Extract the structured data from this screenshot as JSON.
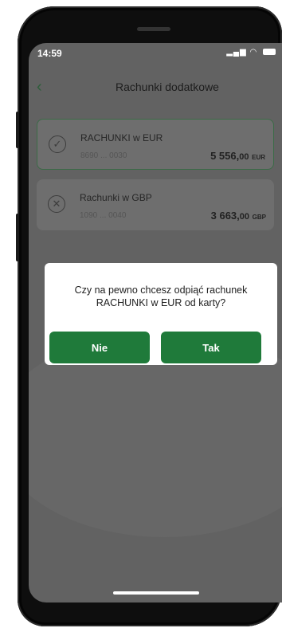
{
  "status": {
    "time": "14:59",
    "icons": "..ıl ᯤ"
  },
  "header": {
    "back": "‹",
    "title": "Rachunki dodatkowe"
  },
  "accounts": [
    {
      "name": "RACHUNKI w EUR",
      "number": "8690 ... 0030",
      "amount_int": "5 556,",
      "amount_dec": "00",
      "currency": "EUR",
      "selected": true
    },
    {
      "name": "Rachunki w GBP",
      "number": "1090 ... 0040",
      "amount_int": "3 663,",
      "amount_dec": "00",
      "currency": "GBP",
      "selected": false
    }
  ],
  "dialog": {
    "message": "Czy na pewno chcesz odpiąć rachunek\nRACHUNKI w EUR  od karty?",
    "no_label": "Nie",
    "yes_label": "Tak"
  },
  "colors": {
    "accent": "#1f7a3a",
    "overlay": "#626262"
  }
}
